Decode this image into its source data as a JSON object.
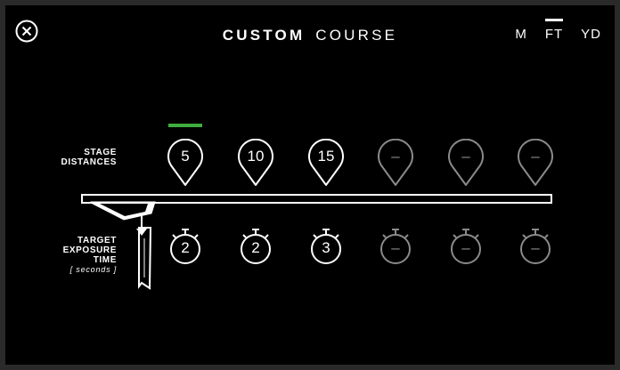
{
  "title": {
    "bold": "CUSTOM",
    "light": "COURSE"
  },
  "units": [
    {
      "label": "M",
      "active": false
    },
    {
      "label": "FT",
      "active": true
    },
    {
      "label": "YD",
      "active": false
    }
  ],
  "labels": {
    "stage_line1": "STAGE",
    "stage_line2": "DISTANCES",
    "target_line1": "TARGET",
    "target_line2": "EXPOSURE",
    "target_line3": "TIME",
    "target_sub": "[ seconds ]"
  },
  "stages": [
    {
      "distance": "5",
      "time": "2",
      "set": true,
      "selected": true
    },
    {
      "distance": "10",
      "time": "2",
      "set": true,
      "selected": false
    },
    {
      "distance": "15",
      "time": "3",
      "set": true,
      "selected": false
    },
    {
      "distance": "–",
      "time": "–",
      "set": false,
      "selected": false
    },
    {
      "distance": "–",
      "time": "–",
      "set": false,
      "selected": false
    },
    {
      "distance": "–",
      "time": "–",
      "set": false,
      "selected": false
    }
  ],
  "colors": {
    "active_white": "#ffffff",
    "inactive_gray": "#8a8a8a",
    "selected_green": "#3fae3f",
    "background": "#000000"
  },
  "icons": {
    "close": "close-circle-icon",
    "pin": "map-pin-icon",
    "timer": "stopwatch-icon"
  }
}
